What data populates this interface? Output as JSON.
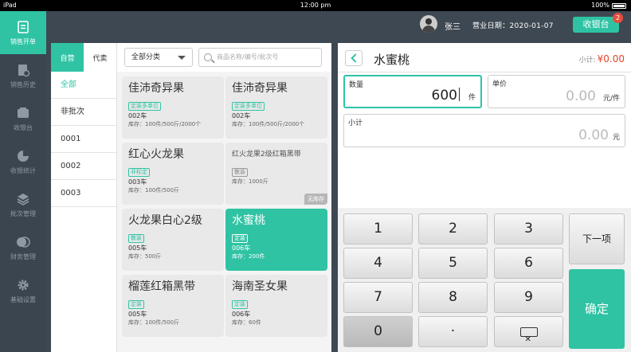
{
  "status_bar": {
    "device": "iPad",
    "time": "12:00 pm",
    "battery": "100%"
  },
  "sidebar": {
    "items": [
      {
        "label": "销售开单",
        "icon": "sales-order-icon"
      },
      {
        "label": "销售历史",
        "icon": "history-icon"
      },
      {
        "label": "收银台",
        "icon": "cashier-icon"
      },
      {
        "label": "收银统计",
        "icon": "stats-icon"
      },
      {
        "label": "批次管理",
        "icon": "layers-icon"
      },
      {
        "label": "财务管理",
        "icon": "finance-icon"
      },
      {
        "label": "基础设置",
        "icon": "gear-icon"
      }
    ]
  },
  "header": {
    "username": "张三",
    "biz_date": "营业日期：2020-01-07",
    "cashier_button": "收银台",
    "badge_count": "2"
  },
  "left_panel": {
    "tabs": [
      "自营",
      "代卖"
    ],
    "batches": [
      "全部",
      "非批次",
      "0001",
      "0002",
      "0003"
    ],
    "category_select": "全部分类",
    "search_placeholder": "商品名称/编号/批次号"
  },
  "products": [
    {
      "name": "佳沛奇异果",
      "tag": "定装多单位",
      "code": "002车",
      "stock": "库存：100件/500斤/2000个"
    },
    {
      "name": "佳沛奇异果",
      "tag": "定装多单位",
      "code": "002车",
      "stock": "库存：100件/500斤/2000个"
    },
    {
      "name": "红心火龙果",
      "tag": "非标定",
      "code": "003车",
      "stock": "库存：100件/500斤"
    },
    {
      "name": "红火龙果2级红箱黑带",
      "tag": "散装",
      "code": "",
      "stock": "库存：1000斤",
      "flag": "无库存"
    },
    {
      "name": "火龙果白心2级",
      "tag": "散装",
      "code": "005车",
      "stock": "库存：500斤"
    },
    {
      "name": "水蜜桃",
      "tag": "定装",
      "code": "006车",
      "stock": "库存：200件"
    },
    {
      "name": "榴莲红箱黑带",
      "tag": "定装",
      "code": "005车",
      "stock": "库存：100件/500斤"
    },
    {
      "name": "海南圣女果",
      "tag": "定装",
      "code": "006车",
      "stock": "库存：60件"
    }
  ],
  "detail": {
    "title": "水蜜桃",
    "subtotal_label": "小计:",
    "subtotal_value": "¥0.00",
    "qty_label": "数量",
    "qty_value": "600",
    "qty_unit": "件",
    "price_label": "单价",
    "price_value": "0.00",
    "price_unit": "元/件",
    "sub_label": "小计",
    "sub_value": "0.00",
    "sub_unit": "元"
  },
  "keypad": {
    "keys": [
      "1",
      "2",
      "3",
      "4",
      "5",
      "6",
      "7",
      "8",
      "9",
      "0",
      "·"
    ],
    "next": "下一项",
    "confirm": "确定",
    "delete_icon": "backspace-icon"
  },
  "colors": {
    "accent": "#2fc3a4",
    "price_red": "#e8452c",
    "sidebar": "#3a4550"
  }
}
